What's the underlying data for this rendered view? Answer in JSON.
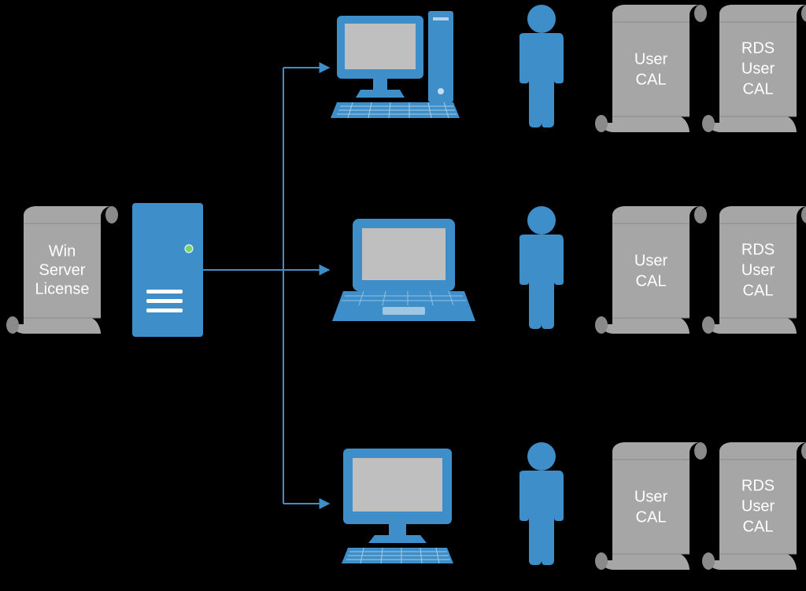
{
  "colors": {
    "blue": "#3d8ec9",
    "gray": "#a6a6a6",
    "grayLine": "#8a8a8a",
    "screenGray": "#bfbfbf"
  },
  "serverLicense": {
    "line1": "Win",
    "line2": "Server",
    "line3": "License"
  },
  "rows": [
    {
      "device": "desktop",
      "userCal": {
        "line1": "User",
        "line2": "CAL"
      },
      "rdsCal": {
        "line1": "RDS",
        "line2": "User",
        "line3": "CAL"
      }
    },
    {
      "device": "laptop",
      "userCal": {
        "line1": "User",
        "line2": "CAL"
      },
      "rdsCal": {
        "line1": "RDS",
        "line2": "User",
        "line3": "CAL"
      }
    },
    {
      "device": "monitor",
      "userCal": {
        "line1": "User",
        "line2": "CAL"
      },
      "rdsCal": {
        "line1": "RDS",
        "line2": "User",
        "line3": "CAL"
      }
    }
  ]
}
